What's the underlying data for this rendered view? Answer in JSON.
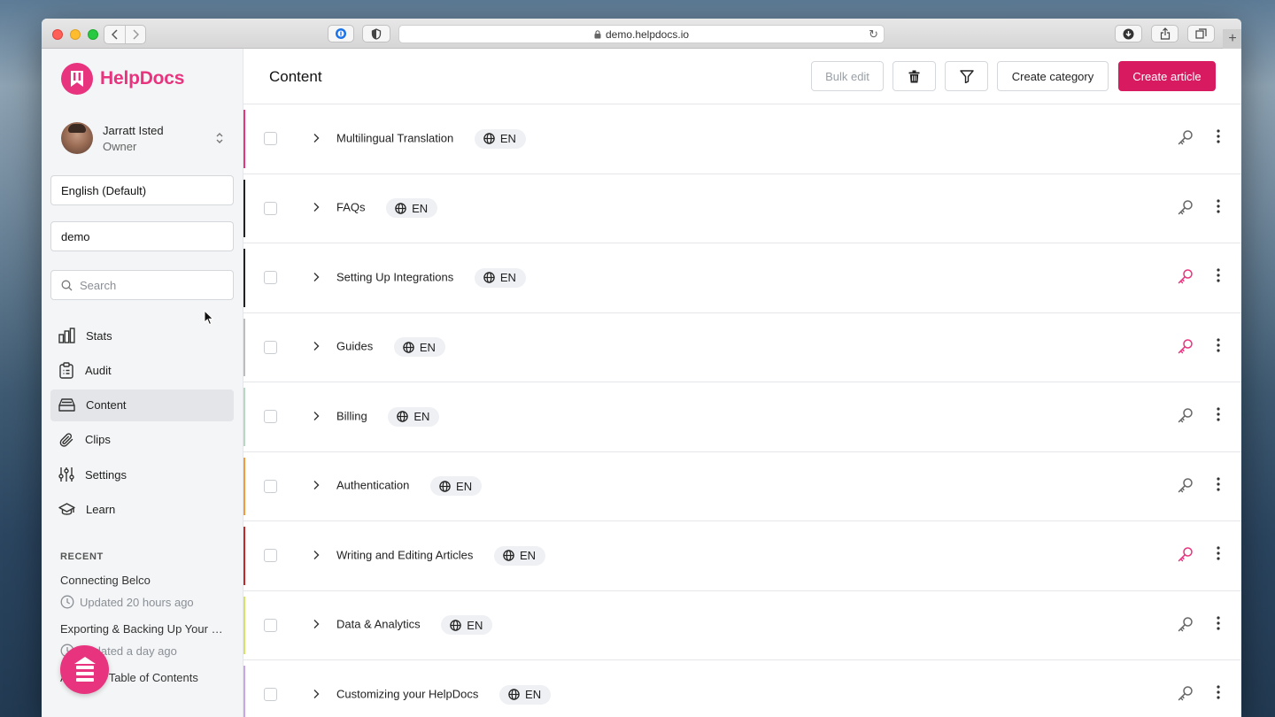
{
  "browser": {
    "url": "demo.helpdocs.io"
  },
  "brand": {
    "name": "HelpDocs",
    "color": "#e8337e"
  },
  "user": {
    "name": "Jarratt Isted",
    "role": "Owner"
  },
  "sidebar": {
    "language": "English (Default)",
    "workspace": "demo",
    "search_placeholder": "Search",
    "nav": [
      {
        "label": "Stats",
        "icon": "bar-chart-icon",
        "active": false
      },
      {
        "label": "Audit",
        "icon": "clipboard-icon",
        "active": false
      },
      {
        "label": "Content",
        "icon": "inbox-icon",
        "active": true
      },
      {
        "label": "Clips",
        "icon": "paperclip-icon",
        "active": false
      },
      {
        "label": "Settings",
        "icon": "sliders-icon",
        "active": false
      },
      {
        "label": "Learn",
        "icon": "graduation-cap-icon",
        "active": false
      }
    ],
    "recent_heading": "RECENT",
    "recent": [
      {
        "title": "Connecting Belco",
        "meta": "Updated 20 hours ago"
      },
      {
        "title": "Exporting & Backing Up Your Content",
        "meta": "Updated a day ago"
      },
      {
        "title": "Adding a Table of Contents",
        "meta": ""
      }
    ]
  },
  "header": {
    "title": "Content",
    "bulk_edit": "Bulk edit",
    "create_category": "Create category",
    "create_article": "Create article",
    "accent": "#d81b60"
  },
  "categories": [
    {
      "title": "Multilingual Translation",
      "lang": "EN",
      "color": "#e8337e",
      "key_color": "#666666"
    },
    {
      "title": "FAQs",
      "lang": "EN",
      "color": "#222222",
      "key_color": "#666666"
    },
    {
      "title": "Setting Up Integrations",
      "lang": "EN",
      "color": "#222222",
      "key_color": "#e8337e"
    },
    {
      "title": "Guides",
      "lang": "EN",
      "color": "#bdbdbd",
      "key_color": "#e8337e"
    },
    {
      "title": "Billing",
      "lang": "EN",
      "color": "#b7d9c3",
      "key_color": "#666666"
    },
    {
      "title": "Authentication",
      "lang": "EN",
      "color": "#f39a3d",
      "key_color": "#666666"
    },
    {
      "title": "Writing and Editing Articles",
      "lang": "EN",
      "color": "#c62828",
      "key_color": "#e8337e"
    },
    {
      "title": "Data & Analytics",
      "lang": "EN",
      "color": "#d4e26a",
      "key_color": "#666666"
    },
    {
      "title": "Customizing your HelpDocs",
      "lang": "EN",
      "color": "#c9a6e8",
      "key_color": "#666666"
    }
  ]
}
